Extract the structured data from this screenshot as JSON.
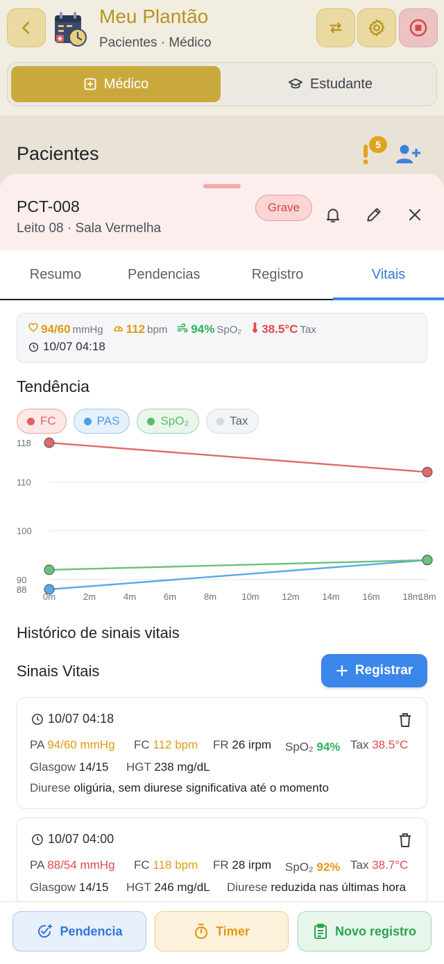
{
  "app": {
    "title": "Meu Plantão",
    "subtitle": "Pacientes · Médico",
    "mode_tabs": [
      "Médico",
      "Estudante"
    ],
    "section": "Pacientes",
    "alert_count": "5"
  },
  "patient": {
    "id": "PCT-008",
    "location": "Leito 08 · Sala Vermelha",
    "severity": "Grave"
  },
  "tabs": [
    "Resumo",
    "Pendencias",
    "Registro",
    "Vitais"
  ],
  "active_tab": "Vitais",
  "latest_vitals": {
    "pa_value": "94/60",
    "pa_unit": "mmHg",
    "fc_value": "112",
    "fc_unit": "bpm",
    "spo2_value": "94%",
    "spo2_unit": "SpO₂",
    "temp_value": "38.5°C",
    "temp_unit": "Tax",
    "time": "10/07 04:18"
  },
  "trend": {
    "title": "Tendência",
    "chips": [
      {
        "label": "FC",
        "color": "#e06060"
      },
      {
        "label": "PAS",
        "color": "#4a9de8"
      },
      {
        "label": "SpO₂",
        "color": "#5bbb6a"
      },
      {
        "label": "Tax",
        "color": "#c9cfd6"
      }
    ]
  },
  "chart_data": {
    "type": "line",
    "x_ticks": [
      "0m",
      "2m",
      "4m",
      "6m",
      "8m",
      "10m",
      "12m",
      "14m",
      "16m",
      "18m",
      "18m"
    ],
    "y_ticks": [
      88,
      90,
      100,
      110,
      118
    ],
    "ylim": [
      88,
      118
    ],
    "xlim": [
      0,
      18
    ],
    "series": [
      {
        "name": "FC",
        "color": "#e06a6a",
        "x": [
          0,
          18
        ],
        "values": [
          118,
          112
        ]
      },
      {
        "name": "PAS",
        "color": "#5aa8e8",
        "x": [
          0,
          18
        ],
        "values": [
          88,
          94
        ]
      },
      {
        "name": "SpO₂",
        "color": "#6cc07a",
        "x": [
          0,
          18
        ],
        "values": [
          92,
          94
        ]
      }
    ]
  },
  "history": {
    "title": "Histórico de sinais vitais",
    "subtitle": "Sinais Vitais",
    "add_label": "Registrar",
    "records": [
      {
        "time": "10/07 04:18",
        "pa_label": "PA",
        "pa": "94/60 mmHg",
        "fc_label": "FC",
        "fc": "112 bpm",
        "fr_label": "FR",
        "fr": "26 irpm",
        "spo2_label": "SpO₂",
        "spo2": "94%",
        "tax_label": "Tax",
        "tax": "38.5°C",
        "glasgow_label": "Glasgow",
        "glasgow": "14/15",
        "hgt_label": "HGT",
        "hgt": "238 mg/dL",
        "diurese_label": "Diurese",
        "diurese": "oligúria, sem diurese significativa até o momento"
      },
      {
        "time": "10/07 04:00",
        "pa_label": "PA",
        "pa": "88/54 mmHg",
        "fc_label": "FC",
        "fc": "118 bpm",
        "fr_label": "FR",
        "fr": "28 irpm",
        "spo2_label": "SpO₂",
        "spo2": "92%",
        "tax_label": "Tax",
        "tax": "38.7°C",
        "glasgow_label": "Glasgow",
        "glasgow": "14/15",
        "hgt_label": "HGT",
        "hgt": "246 mg/dL",
        "diurese_label": "Diurese",
        "diurese": "reduzida nas últimas hora"
      }
    ]
  },
  "bottom_actions": [
    "Pendencia",
    "Timer",
    "Novo registro"
  ]
}
